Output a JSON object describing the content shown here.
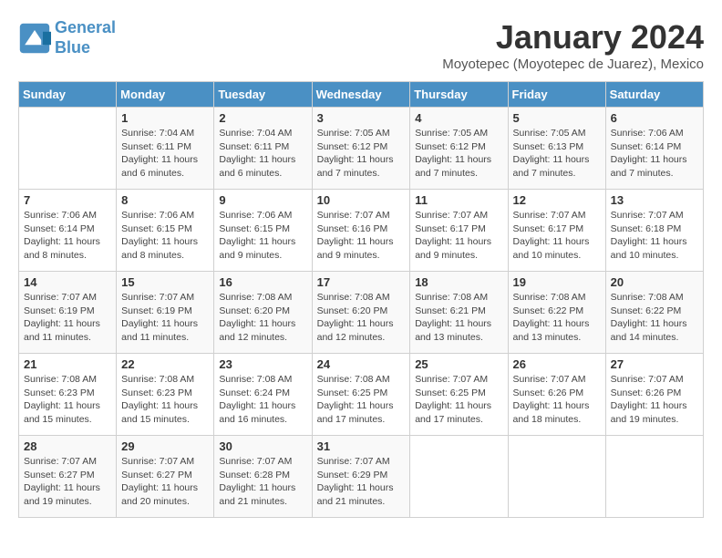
{
  "header": {
    "logo_line1": "General",
    "logo_line2": "Blue",
    "month_title": "January 2024",
    "subtitle": "Moyotepec (Moyotepec de Juarez), Mexico"
  },
  "days_of_week": [
    "Sunday",
    "Monday",
    "Tuesday",
    "Wednesday",
    "Thursday",
    "Friday",
    "Saturday"
  ],
  "weeks": [
    [
      {
        "num": "",
        "detail": ""
      },
      {
        "num": "1",
        "detail": "Sunrise: 7:04 AM\nSunset: 6:11 PM\nDaylight: 11 hours\nand 6 minutes."
      },
      {
        "num": "2",
        "detail": "Sunrise: 7:04 AM\nSunset: 6:11 PM\nDaylight: 11 hours\nand 6 minutes."
      },
      {
        "num": "3",
        "detail": "Sunrise: 7:05 AM\nSunset: 6:12 PM\nDaylight: 11 hours\nand 7 minutes."
      },
      {
        "num": "4",
        "detail": "Sunrise: 7:05 AM\nSunset: 6:12 PM\nDaylight: 11 hours\nand 7 minutes."
      },
      {
        "num": "5",
        "detail": "Sunrise: 7:05 AM\nSunset: 6:13 PM\nDaylight: 11 hours\nand 7 minutes."
      },
      {
        "num": "6",
        "detail": "Sunrise: 7:06 AM\nSunset: 6:14 PM\nDaylight: 11 hours\nand 7 minutes."
      }
    ],
    [
      {
        "num": "7",
        "detail": "Sunrise: 7:06 AM\nSunset: 6:14 PM\nDaylight: 11 hours\nand 8 minutes."
      },
      {
        "num": "8",
        "detail": "Sunrise: 7:06 AM\nSunset: 6:15 PM\nDaylight: 11 hours\nand 8 minutes."
      },
      {
        "num": "9",
        "detail": "Sunrise: 7:06 AM\nSunset: 6:15 PM\nDaylight: 11 hours\nand 9 minutes."
      },
      {
        "num": "10",
        "detail": "Sunrise: 7:07 AM\nSunset: 6:16 PM\nDaylight: 11 hours\nand 9 minutes."
      },
      {
        "num": "11",
        "detail": "Sunrise: 7:07 AM\nSunset: 6:17 PM\nDaylight: 11 hours\nand 9 minutes."
      },
      {
        "num": "12",
        "detail": "Sunrise: 7:07 AM\nSunset: 6:17 PM\nDaylight: 11 hours\nand 10 minutes."
      },
      {
        "num": "13",
        "detail": "Sunrise: 7:07 AM\nSunset: 6:18 PM\nDaylight: 11 hours\nand 10 minutes."
      }
    ],
    [
      {
        "num": "14",
        "detail": "Sunrise: 7:07 AM\nSunset: 6:19 PM\nDaylight: 11 hours\nand 11 minutes."
      },
      {
        "num": "15",
        "detail": "Sunrise: 7:07 AM\nSunset: 6:19 PM\nDaylight: 11 hours\nand 11 minutes."
      },
      {
        "num": "16",
        "detail": "Sunrise: 7:08 AM\nSunset: 6:20 PM\nDaylight: 11 hours\nand 12 minutes."
      },
      {
        "num": "17",
        "detail": "Sunrise: 7:08 AM\nSunset: 6:20 PM\nDaylight: 11 hours\nand 12 minutes."
      },
      {
        "num": "18",
        "detail": "Sunrise: 7:08 AM\nSunset: 6:21 PM\nDaylight: 11 hours\nand 13 minutes."
      },
      {
        "num": "19",
        "detail": "Sunrise: 7:08 AM\nSunset: 6:22 PM\nDaylight: 11 hours\nand 13 minutes."
      },
      {
        "num": "20",
        "detail": "Sunrise: 7:08 AM\nSunset: 6:22 PM\nDaylight: 11 hours\nand 14 minutes."
      }
    ],
    [
      {
        "num": "21",
        "detail": "Sunrise: 7:08 AM\nSunset: 6:23 PM\nDaylight: 11 hours\nand 15 minutes."
      },
      {
        "num": "22",
        "detail": "Sunrise: 7:08 AM\nSunset: 6:23 PM\nDaylight: 11 hours\nand 15 minutes."
      },
      {
        "num": "23",
        "detail": "Sunrise: 7:08 AM\nSunset: 6:24 PM\nDaylight: 11 hours\nand 16 minutes."
      },
      {
        "num": "24",
        "detail": "Sunrise: 7:08 AM\nSunset: 6:25 PM\nDaylight: 11 hours\nand 17 minutes."
      },
      {
        "num": "25",
        "detail": "Sunrise: 7:07 AM\nSunset: 6:25 PM\nDaylight: 11 hours\nand 17 minutes."
      },
      {
        "num": "26",
        "detail": "Sunrise: 7:07 AM\nSunset: 6:26 PM\nDaylight: 11 hours\nand 18 minutes."
      },
      {
        "num": "27",
        "detail": "Sunrise: 7:07 AM\nSunset: 6:26 PM\nDaylight: 11 hours\nand 19 minutes."
      }
    ],
    [
      {
        "num": "28",
        "detail": "Sunrise: 7:07 AM\nSunset: 6:27 PM\nDaylight: 11 hours\nand 19 minutes."
      },
      {
        "num": "29",
        "detail": "Sunrise: 7:07 AM\nSunset: 6:27 PM\nDaylight: 11 hours\nand 20 minutes."
      },
      {
        "num": "30",
        "detail": "Sunrise: 7:07 AM\nSunset: 6:28 PM\nDaylight: 11 hours\nand 21 minutes."
      },
      {
        "num": "31",
        "detail": "Sunrise: 7:07 AM\nSunset: 6:29 PM\nDaylight: 11 hours\nand 21 minutes."
      },
      {
        "num": "",
        "detail": ""
      },
      {
        "num": "",
        "detail": ""
      },
      {
        "num": "",
        "detail": ""
      }
    ]
  ]
}
